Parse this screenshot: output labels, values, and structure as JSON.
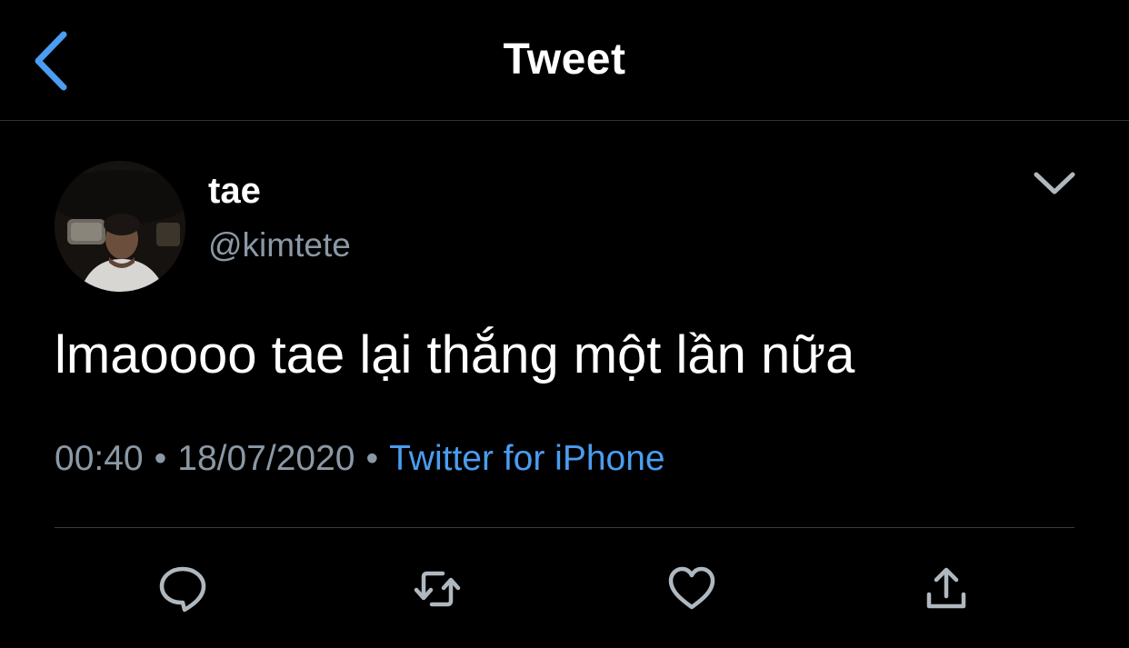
{
  "header": {
    "title": "Tweet",
    "back_icon": "chevron-left-icon"
  },
  "tweet": {
    "author": {
      "display_name": "tae",
      "handle": "@kimtete"
    },
    "text": "lmaoooo tae lại thắng một lần nữa",
    "time": "00:40",
    "date": "18/07/2020",
    "separator": "•",
    "source": "Twitter for iPhone"
  },
  "actions": [
    {
      "name": "reply",
      "icon": "reply-icon"
    },
    {
      "name": "retweet",
      "icon": "retweet-icon"
    },
    {
      "name": "like",
      "icon": "heart-icon"
    },
    {
      "name": "share",
      "icon": "share-icon"
    }
  ],
  "colors": {
    "background": "#000000",
    "accent": "#4a9df0",
    "secondary_text": "#8b98a5",
    "icon_gray": "#b0b8bf",
    "divider": "#2f3336"
  }
}
